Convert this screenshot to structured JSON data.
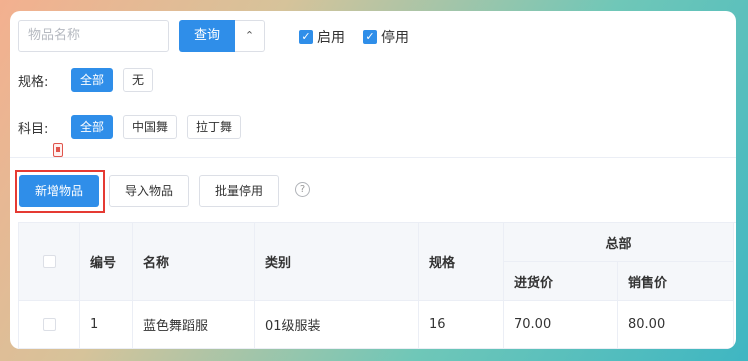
{
  "search": {
    "placeholder": "物品名称",
    "query_label": "查询",
    "expand_icon": "chevrons-up-icon"
  },
  "filters": {
    "enabled_label": "启用",
    "disabled_label": "停用",
    "spec": {
      "label": "规格:",
      "options": [
        "全部",
        "无"
      ],
      "selected": "全部"
    },
    "subject": {
      "label": "科目:",
      "options": [
        "全部",
        "中国舞",
        "拉丁舞"
      ],
      "selected": "全部"
    }
  },
  "toolbar": {
    "add_label": "新增物品",
    "import_label": "导入物品",
    "batch_disable_label": "批量停用",
    "help_icon": "help-icon"
  },
  "table": {
    "columns": [
      "编号",
      "名称",
      "类别",
      "规格"
    ],
    "group_header": "总部",
    "sub_columns": [
      "进货价",
      "销售价"
    ],
    "rows": [
      {
        "no": "1",
        "name": "蓝色舞蹈服",
        "category": "01级服装",
        "spec": "16",
        "purchase": "70.00",
        "sale": "80.00"
      }
    ]
  },
  "colors": {
    "accent": "#2f8ee9",
    "highlight": "#e53a33"
  }
}
